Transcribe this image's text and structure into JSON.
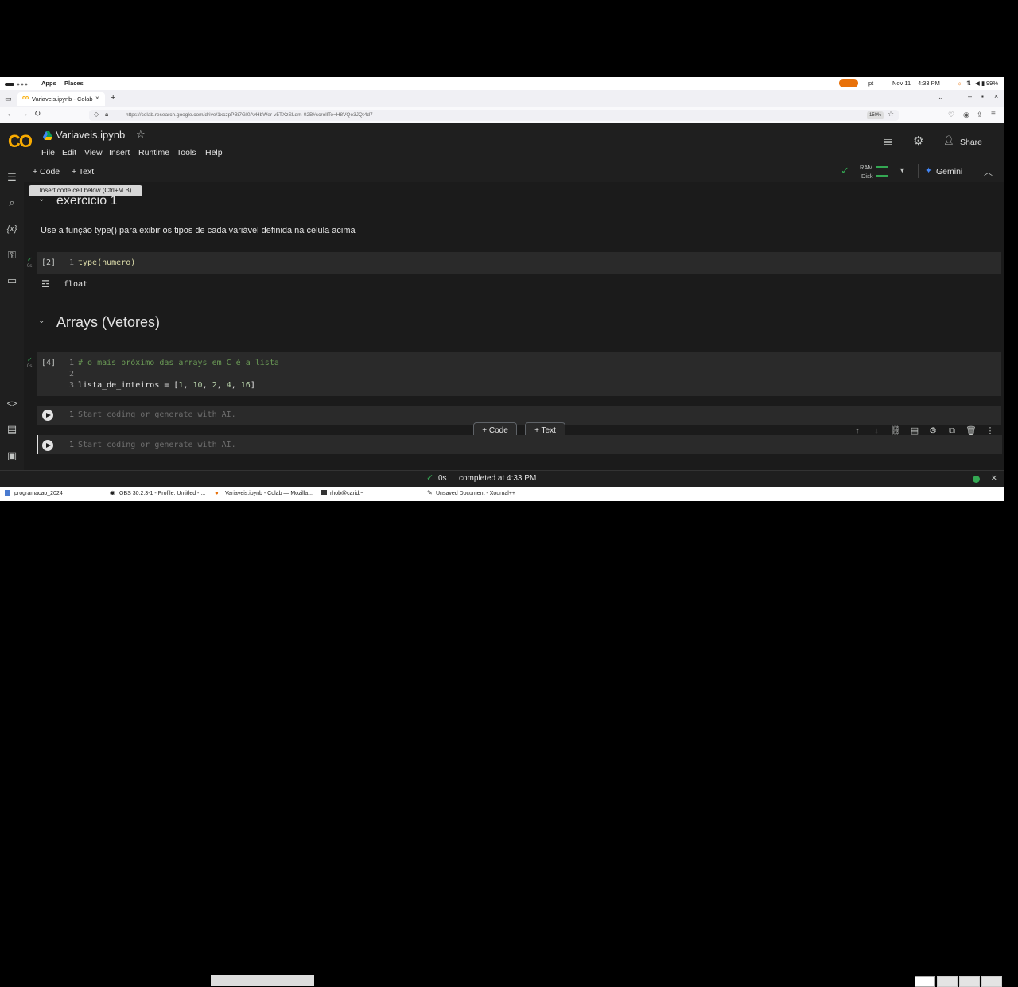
{
  "os_bar": {
    "apps": "Apps",
    "places": "Places",
    "lang": "pt",
    "date": "Nov 11",
    "time": "4:33 PM",
    "battery": "99%"
  },
  "browser": {
    "tab_title": "Variaveis.ipynb - Colab",
    "new_tab": "+",
    "url": "https://colab.research.google.com/drive/1xczpPBi7GI0AvHbWer-v5TXzSLdm-02B#scrollTo=H8VQe3JQt4d7",
    "zoom": "150%"
  },
  "colab": {
    "logo": "CO",
    "notebook_title": "Variaveis.ipynb",
    "menu": [
      "File",
      "Edit",
      "View",
      "Insert",
      "Runtime",
      "Tools",
      "Help"
    ],
    "share": "Share",
    "toolbar": {
      "add_code": "+ Code",
      "add_text": "+ Text",
      "ram": "RAM",
      "disk": "Disk",
      "gemini": "Gemini"
    },
    "tooltip": "Insert code cell below (Ctrl+M B)",
    "heading_exercise": "exercicio 1",
    "text_instruction": "Use a função type() para exibir os tipos de cada variável definida na celula acima",
    "cell1": {
      "exec_count": "[2]",
      "line_no": "1",
      "code": "type(numero)",
      "output": "float",
      "time": "0s"
    },
    "heading_arrays": "Arrays (Vetores)",
    "cell2": {
      "exec_count": "[4]",
      "time": "0s",
      "lines": [
        {
          "n": "1",
          "text": "# o mais próximo das arrays em C é a lista"
        },
        {
          "n": "2",
          "text": ""
        },
        {
          "n": "3",
          "text_pre": "lista_de_inteiros = [",
          "v1": "1",
          "v2": "10",
          "v3": "2",
          "v4": "4",
          "v5": "16",
          "text_post": "]"
        }
      ]
    },
    "cell3": {
      "line_no": "1",
      "placeholder": "Start coding or generate with AI."
    },
    "cell4": {
      "line_no": "1",
      "placeholder": "Start coding or generate with AI."
    },
    "float_code": "+ Code",
    "float_text": "+ Text",
    "status": {
      "time": "0s",
      "message": "completed at 4:33 PM"
    }
  },
  "taskbar": {
    "items": [
      "programacao_2024",
      "OBS 30.2.3-1 - Profile: Untitled - ...",
      "Variaveis.ipynb - Colab — Mozilla...",
      "rhob@carid:~",
      "Unsaved Document - Xournal++"
    ]
  },
  "colors": {
    "colab_bg": "#1f1f1f",
    "cell_bg": "#2a2a2a",
    "accent_green": "#34a853",
    "logo_orange": "#f9ab00"
  }
}
